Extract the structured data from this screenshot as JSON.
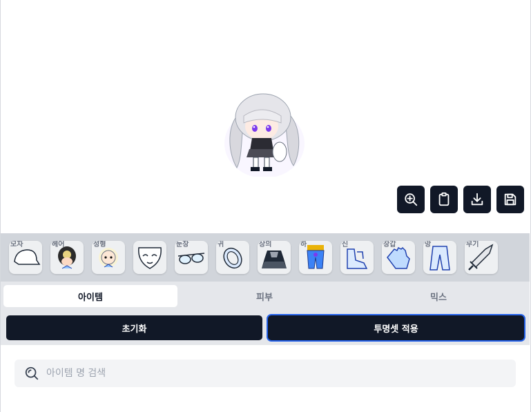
{
  "preview": {
    "tools": [
      {
        "icon": "zoom-in-icon"
      },
      {
        "icon": "clipboard-icon"
      },
      {
        "icon": "download-icon"
      },
      {
        "icon": "save-icon"
      }
    ]
  },
  "slots": [
    {
      "label": "모자",
      "icon": "hat-icon"
    },
    {
      "label": "헤어",
      "icon": "hair-icon"
    },
    {
      "label": "성형",
      "icon": "face-icon"
    },
    {
      "label": "",
      "icon": "face-accessory-icon"
    },
    {
      "label": "눈장",
      "icon": "eye-accessory-icon"
    },
    {
      "label": "귀",
      "icon": "earring-icon"
    },
    {
      "label": "상의",
      "icon": "top-icon"
    },
    {
      "label": "하",
      "icon": "bottom-icon"
    },
    {
      "label": "신",
      "icon": "shoes-icon"
    },
    {
      "label": "장갑",
      "icon": "gloves-icon"
    },
    {
      "label": "망",
      "icon": "cape-icon"
    },
    {
      "label": "무기",
      "icon": "weapon-icon"
    }
  ],
  "tabs": [
    {
      "label": "아이템",
      "active": true
    },
    {
      "label": "피부",
      "active": false
    },
    {
      "label": "믹스",
      "active": false
    }
  ],
  "actions": {
    "reset": "초기화",
    "apply_transparent": "투명셋 적용"
  },
  "search": {
    "placeholder": "아이템 명 검색",
    "value": ""
  },
  "colors": {
    "button_dark": "#111827",
    "slot_bar": "#d1d5db",
    "tab_bar": "#e5e7eb",
    "focus_ring": "#2563eb"
  }
}
